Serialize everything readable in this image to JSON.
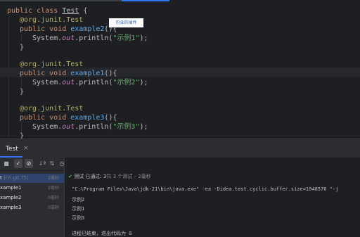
{
  "editor": {
    "class_line": {
      "kw1": "public",
      "kw2": "class",
      "name": "Test",
      "brace": " {"
    },
    "methods": [
      {
        "annotation": "@org.junit.Test",
        "kw": "public void ",
        "name": "example2",
        "sig": "(){",
        "print_prefix": "System.",
        "print_out": "out",
        "print_call": ".println(",
        "print_arg": "\"示例1\"",
        "print_end": ");",
        "close": "}"
      },
      {
        "annotation": "@org.junit.Test",
        "kw": "public void ",
        "name": "example1",
        "sig": "(){",
        "print_prefix": "System.",
        "print_out": "out",
        "print_call": ".println(",
        "print_arg": "\"示例2\"",
        "print_end": ");",
        "close": "}"
      },
      {
        "annotation": "@org.junit.Test",
        "kw": "public void ",
        "name": "example3",
        "sig": "(){",
        "print_prefix": "System.",
        "print_out": "out",
        "print_call": ".println(",
        "print_arg": "\"示例3\"",
        "print_end": ");",
        "close": "}"
      }
    ],
    "tooltip": "包含的插件"
  },
  "panel": {
    "title": "Test",
    "close": "×"
  },
  "toolbar": {
    "icons": [
      "stop-icon",
      "check-icon",
      "stop-circle-icon",
      "sort-icon",
      "sort-duration-icon",
      "history-icon",
      "import-icon",
      "export-icon",
      "more-icon"
    ]
  },
  "tree": {
    "rows": [
      {
        "name": "t",
        "sub": "(cn.gd.T5)",
        "time": "2毫秒",
        "selected": true
      },
      {
        "name": "xample1",
        "sub": "",
        "time": "2毫秒",
        "selected": false
      },
      {
        "name": "xample2",
        "sub": "",
        "time": "0毫秒",
        "selected": false
      },
      {
        "name": "xample3",
        "sub": "",
        "time": "0毫秒",
        "selected": false
      }
    ]
  },
  "console": {
    "status_prefix": "测试 已通过:",
    "status_count": " 3",
    "status_rest": "共 3 个测试 – 2毫秒",
    "command": "\"C:\\Program Files\\Java\\jdk-21\\bin\\java.exe\" -ea -Didea.test.cyclic.buffer.size=1048576 \"-j",
    "outputs": [
      "示例2",
      "示例1",
      "示例3"
    ],
    "exit": "进程已结束，退出代码为 0"
  }
}
